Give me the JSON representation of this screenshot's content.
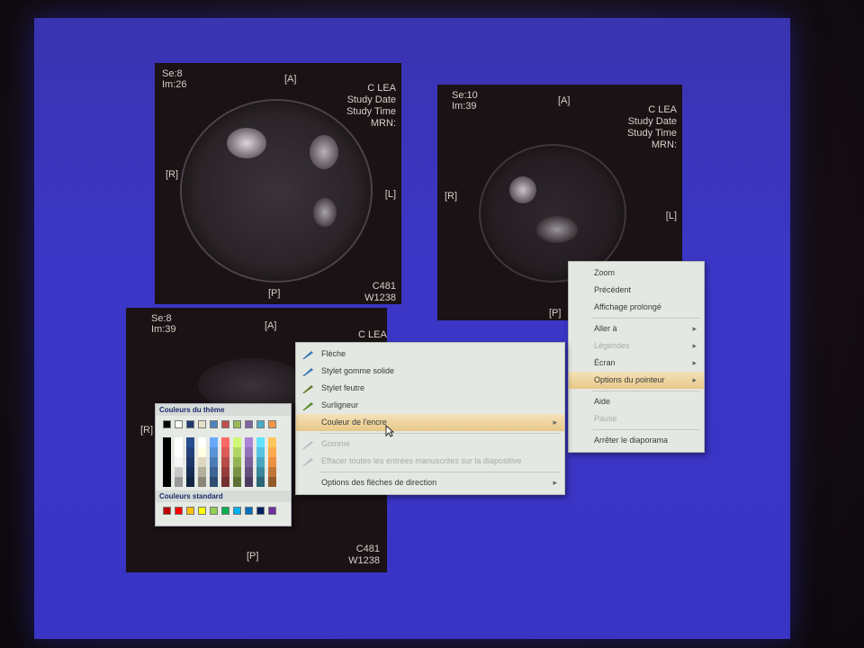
{
  "scans": {
    "top_left": {
      "series": "Se:8",
      "image": "Im:26",
      "ant": "[A]",
      "post": "[P]",
      "right": "[R]",
      "left": "[L]",
      "info": "C LEA\nStudy Date\nStudy Time\nMRN:",
      "window": "C481\nW1238"
    },
    "top_right": {
      "series": "Se:10",
      "image": "Im:39",
      "ant": "[A]",
      "post": "[P]",
      "right": "[R]",
      "left": "[L]",
      "info": "C LEA\nStudy Date\nStudy Time\nMRN:"
    },
    "bottom_left": {
      "series": "Se:8",
      "image": "Im:39",
      "ant": "[A]",
      "post": "[P]",
      "right": "[R]",
      "info": "C LEA",
      "window": "C481\nW1238"
    }
  },
  "context_menu": {
    "items": [
      {
        "label": "Zoom",
        "state": "normal"
      },
      {
        "label": "Précédent",
        "state": "normal"
      },
      {
        "label": "Affichage prolongé",
        "state": "normal"
      },
      {
        "label": "Aller à",
        "state": "normal",
        "sub": true
      },
      {
        "label": "Légendes",
        "state": "disabled",
        "sub": true
      },
      {
        "label": "Écran",
        "state": "normal",
        "sub": true
      },
      {
        "label": "Options du pointeur",
        "state": "highlighted",
        "sub": true
      },
      {
        "label": "Aide",
        "state": "normal"
      },
      {
        "label": "Pause",
        "state": "disabled"
      },
      {
        "label": "Arrêter le diaporama",
        "state": "normal"
      }
    ]
  },
  "pointer_menu": {
    "items": [
      {
        "label": "Flèche",
        "icon": "arrow-icon",
        "state": "normal"
      },
      {
        "label": "Stylet gomme solide",
        "icon": "pen-icon",
        "state": "normal"
      },
      {
        "label": "Stylet feutre",
        "icon": "felt-pen-icon",
        "state": "normal"
      },
      {
        "label": "Surligneur",
        "icon": "highlighter-icon",
        "state": "normal"
      },
      {
        "label": "Couleur de l'encre",
        "icon": "",
        "state": "highlighted",
        "sub": true
      },
      {
        "label": "Gomme",
        "icon": "eraser-icon",
        "state": "disabled"
      },
      {
        "label": "Effacer toutes les entrées manuscrites sur la diapositive",
        "icon": "erase-all-icon",
        "state": "disabled"
      },
      {
        "label": "Options des flèches de direction",
        "icon": "",
        "state": "normal",
        "sub": true
      }
    ]
  },
  "palette": {
    "theme_title": "Couleurs du thème",
    "standard_title": "Couleurs standard",
    "theme_colors": [
      "#000000",
      "#ffffff",
      "#1f3a6e",
      "#e6e0c8",
      "#4f81bd",
      "#c0504d",
      "#9bbb59",
      "#8064a2",
      "#4bacc6",
      "#f79646"
    ],
    "standard_colors": [
      "#c00000",
      "#ff0000",
      "#ffc000",
      "#ffff00",
      "#92d050",
      "#00b050",
      "#00b0f0",
      "#0070c0",
      "#002060",
      "#7030a0"
    ]
  }
}
